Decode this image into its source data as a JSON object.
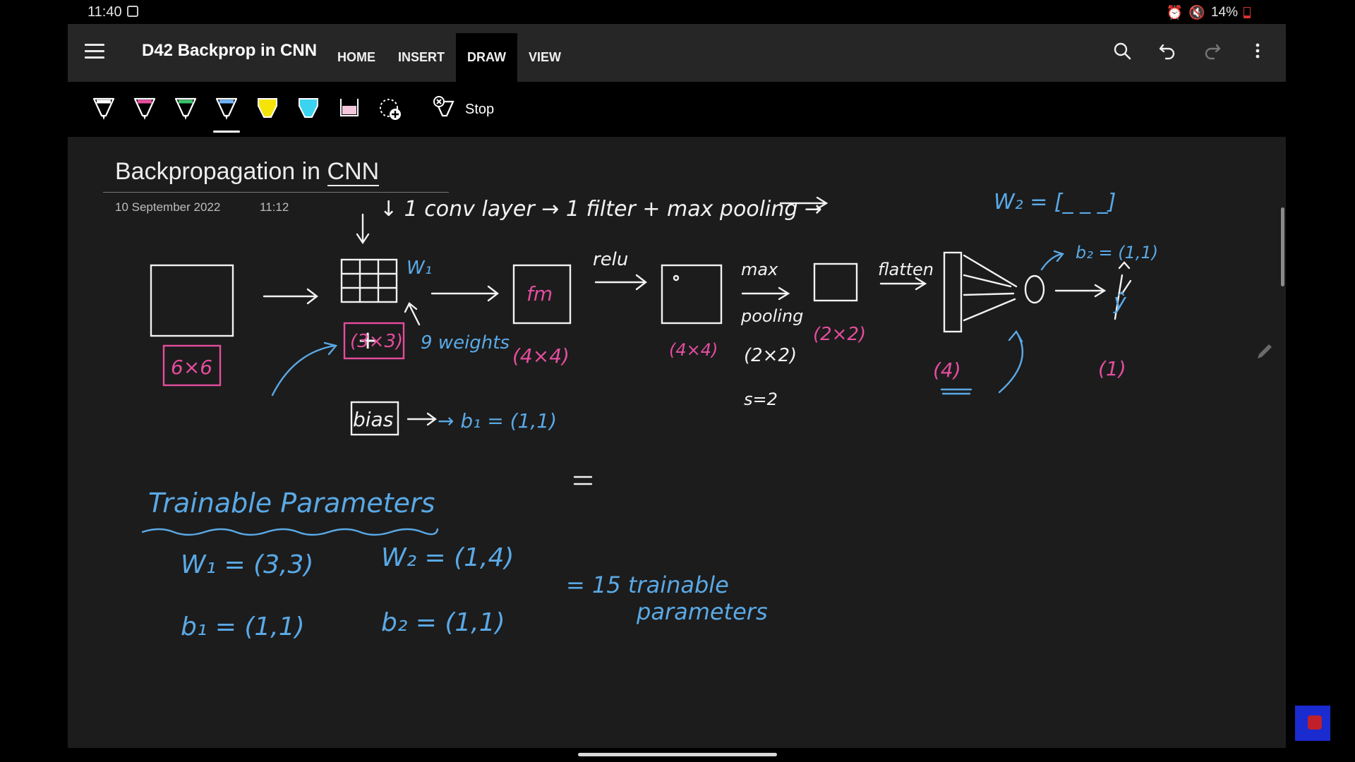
{
  "status": {
    "time": "11:40",
    "battery": "14%"
  },
  "app": {
    "title": "D42 Backprop in CNN",
    "tabs": [
      "HOME",
      "INSERT",
      "DRAW",
      "VIEW"
    ],
    "active_tab": "DRAW"
  },
  "toolbar": {
    "pens": [
      {
        "name": "white-pen",
        "color": "#ffffff"
      },
      {
        "name": "pink-pen",
        "color": "#e84f9c"
      },
      {
        "name": "green-pen",
        "color": "#3cc46a"
      },
      {
        "name": "blue-pen",
        "color": "#6fb6ff",
        "selected": true
      },
      {
        "name": "yellow-highlighter",
        "color": "#f4e409"
      },
      {
        "name": "cyan-highlighter",
        "color": "#3bd4f0"
      },
      {
        "name": "pink-highlighter",
        "color": "#f3c6dc"
      }
    ],
    "stop_label": "Stop"
  },
  "page": {
    "title_prefix": "Backpropagation in ",
    "title_link": "CNN",
    "date": "10 September 2022",
    "time": "11:12"
  },
  "notes": {
    "header_note": "↓ 1 conv layer → 1 filter + max pooling →",
    "w2_vector": "W₂ = [_ _ _]",
    "input_size": "6×6",
    "w1_label": "W₁",
    "filter_size": "(3×3)",
    "weights_note": "9 weights",
    "plus": "+",
    "bias_box": "bias",
    "b1_note": "→ b₁ = (1,1)",
    "conv_box": "fm",
    "conv_size": "(4×4)",
    "relu": "relu",
    "relu_size": "(4×4)",
    "max": "max",
    "pooling": "pooling",
    "pool_window": "(2×2)",
    "stride": "s=2",
    "pool_size": "(2×2)",
    "flatten": "flatten",
    "flat_size": "(4)",
    "b2_label": "b₂ = (1,1)",
    "y_hat": "ŷ",
    "out_size": "(1)",
    "trainable_title": "Trainable Parameters",
    "w1_eq": "W₁ = (3,3)",
    "b1_eq": "b₁ = (1,1)",
    "w2_eq": "W₂ = (1,4)",
    "b2_eq": "b₂ = (1,1)",
    "total_line1": "= 15 trainable",
    "total_line2": "parameters"
  },
  "colors": {
    "ink_white": "#f2f2f2",
    "ink_blue": "#5aa9e6",
    "ink_pink": "#e44d9e"
  }
}
